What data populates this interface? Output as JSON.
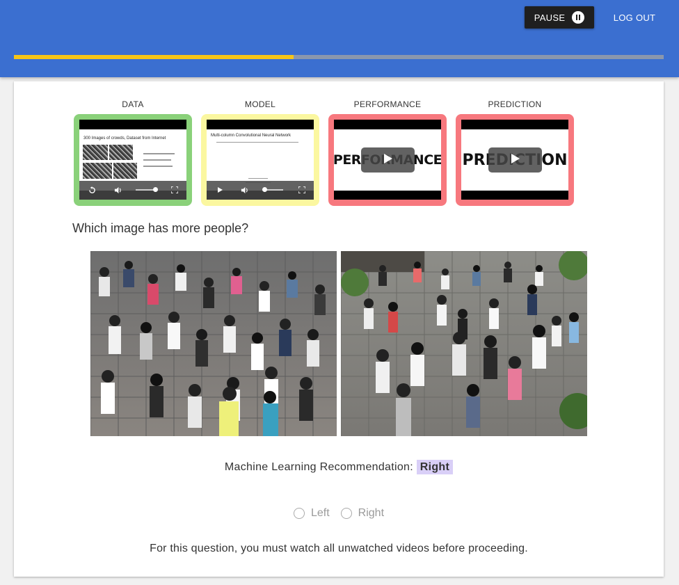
{
  "header": {
    "pause_label": "PAUSE",
    "logout_label": "LOG OUT",
    "progress_fraction": 0.43,
    "colors": {
      "bar": "#3b6fd0",
      "progress": "#f5c518",
      "track": "#8a97ad"
    }
  },
  "videos": [
    {
      "label": "DATA",
      "status_color": "#8ad17a",
      "slide_title": "300 Images of crowds, Dataset from Internet"
    },
    {
      "label": "MODEL",
      "status_color": "#fbf7a0",
      "slide_title": "Multi-column Convolutional Neural Network"
    },
    {
      "label": "PERFORMANCE",
      "status_color": "#f7787e",
      "title_card": "PERFORMANCE"
    },
    {
      "label": "PREDICTION",
      "status_color": "#f7787e",
      "title_card": "PREDICTION"
    }
  ],
  "question": "Which image has more people?",
  "recommendation": {
    "prefix": "Machine Learning Recommendation:",
    "value": "Right"
  },
  "choices": [
    {
      "label": "Left",
      "selected": false
    },
    {
      "label": "Right",
      "selected": false
    }
  ],
  "notice": "For this question, you must watch all unwatched videos before proceeding."
}
